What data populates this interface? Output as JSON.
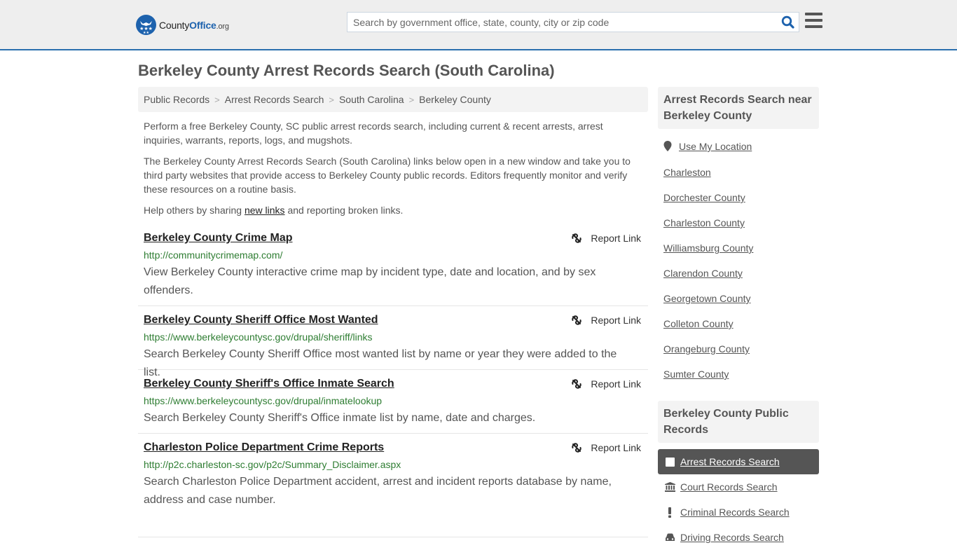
{
  "header": {
    "logo": {
      "name": "County",
      "name_bold": "Office",
      "tld": ".org"
    },
    "search": {
      "placeholder": "Search by government office, state, county, city or zip code",
      "value": ""
    },
    "accent_color": "#1d62ad"
  },
  "page": {
    "title": "Berkeley County Arrest Records Search (South Carolina)",
    "breadcrumb": [
      "Public Records",
      "Arrest Records Search",
      "South Carolina",
      "Berkeley County"
    ],
    "breadcrumb_separator": ">",
    "intro": {
      "p1": "Perform a free Berkeley County, SC public arrest records search, including current & recent arrests, arrest inquiries, warrants, reports, logs, and mugshots.",
      "p2": "The Berkeley County Arrest Records Search (South Carolina) links below open in a new window and take you to third party websites that provide access to Berkeley County public records. Editors frequently monitor and verify these resources on a routine basis.",
      "p3_before": "Help others by sharing ",
      "p3_link": "new links",
      "p3_after": " and reporting broken links."
    }
  },
  "listings": [
    {
      "title": "Berkeley County Crime Map",
      "url": "http://communitycrimemap.com/",
      "description": "View Berkeley County interactive crime map by incident type, date and location, and by sex offenders.",
      "report_label": "Report Link"
    },
    {
      "title": "Berkeley County Sheriff Office Most Wanted",
      "url": "https://www.berkeleycountysc.gov/drupal/sheriff/links",
      "description": "Search Berkeley County Sheriff Office most wanted list by name or year they were added to the list.",
      "report_label": "Report Link"
    },
    {
      "title": "Berkeley County Sheriff's Office Inmate Search",
      "url": "https://www.berkeleycountysc.gov/drupal/inmatelookup",
      "description": "Search Berkeley County Sheriff's Office inmate list by name, date and charges.",
      "report_label": "Report Link"
    },
    {
      "title": "Charleston Police Department Crime Reports",
      "url": "http://p2c.charleston-sc.gov/p2c/Summary_Disclaimer.aspx",
      "description": "Search Charleston Police Department accident, arrest and incident reports database by name, address and case number.",
      "report_label": "Report Link"
    }
  ],
  "sidebar": {
    "nearby": {
      "heading": "Arrest Records Search near Berkeley County",
      "use_location": "Use My Location",
      "links": [
        "Charleston",
        "Dorchester County",
        "Charleston County",
        "Williamsburg County",
        "Clarendon County",
        "Georgetown County",
        "Colleton County",
        "Orangeburg County",
        "Sumter County"
      ]
    },
    "public_records": {
      "heading": "Berkeley County Public Records",
      "items": [
        {
          "label": "Arrest Records Search",
          "icon": "square-icon",
          "active": true
        },
        {
          "label": "Court Records Search",
          "icon": "courthouse-icon",
          "active": false
        },
        {
          "label": "Criminal Records Search",
          "icon": "exclamation-icon",
          "active": false
        },
        {
          "label": "Driving Records Search",
          "icon": "car-icon",
          "active": false
        }
      ]
    }
  }
}
